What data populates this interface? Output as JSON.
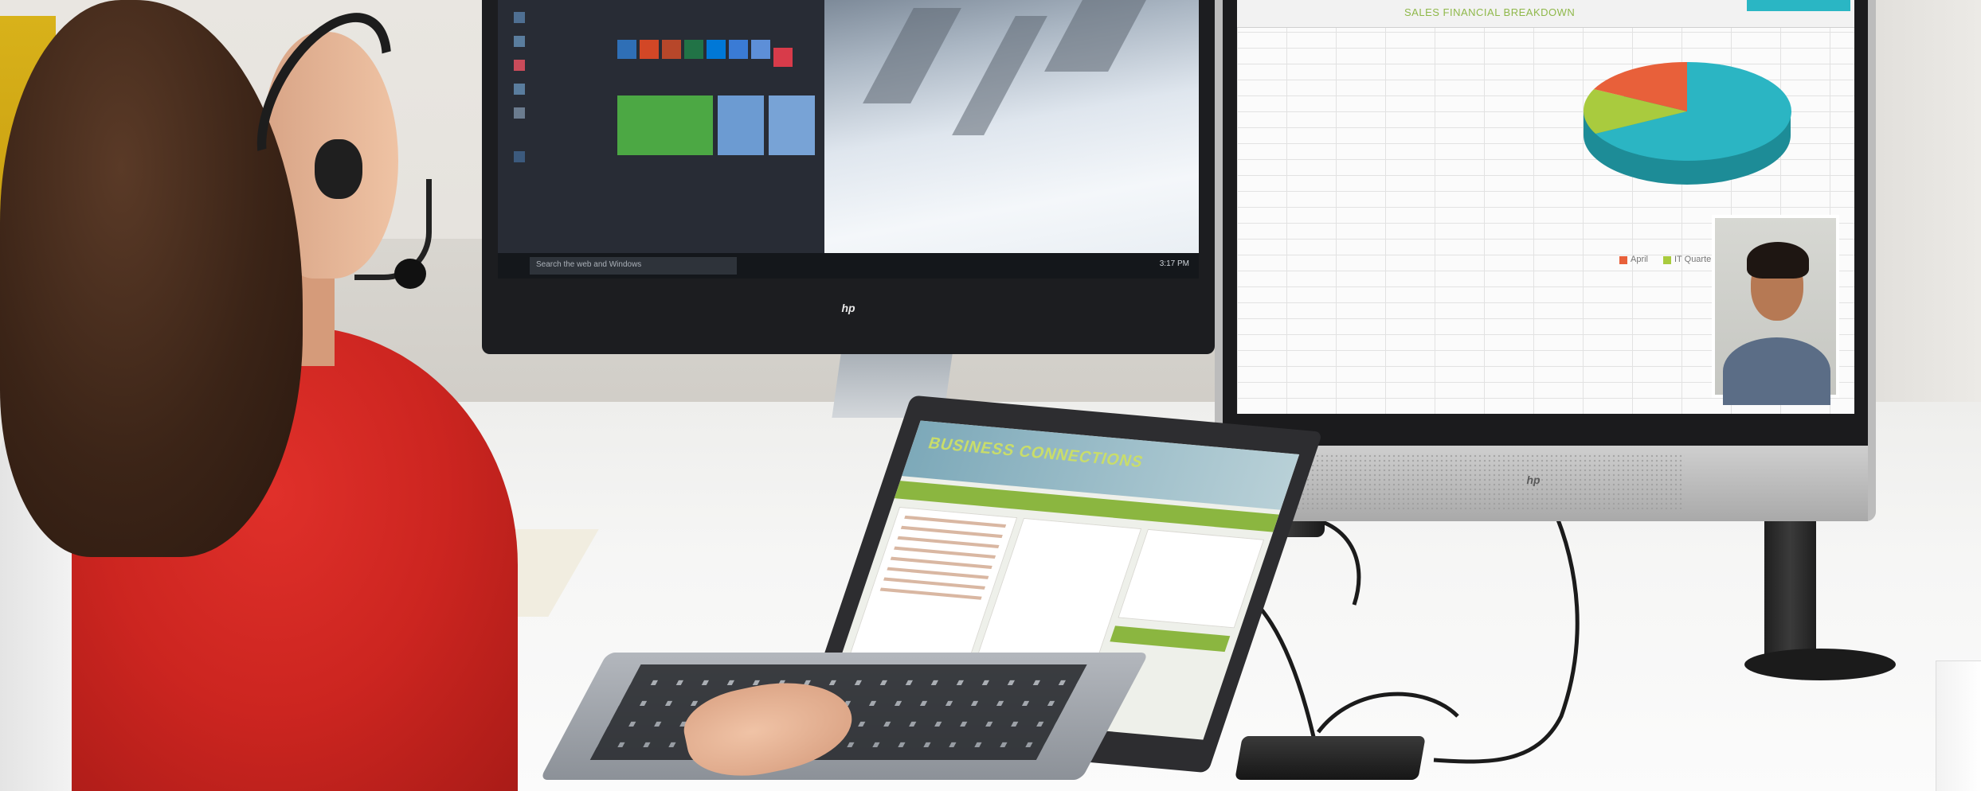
{
  "scene": {
    "left_monitor": {
      "brand": "hp",
      "search_placeholder": "Search the web and Windows",
      "tray_time": "3:17 PM"
    },
    "right_monitor": {
      "brand": "hp",
      "sheet_title": "SALES FINANCIAL BREAKDOWN",
      "pie_colors": [
        "#2bb5c3",
        "#a9cb3e",
        "#e8603a"
      ],
      "legend": [
        "April",
        "IT Quarter"
      ]
    },
    "laptop": {
      "app_logo": "BUSINESS CONNECTIONS"
    }
  }
}
